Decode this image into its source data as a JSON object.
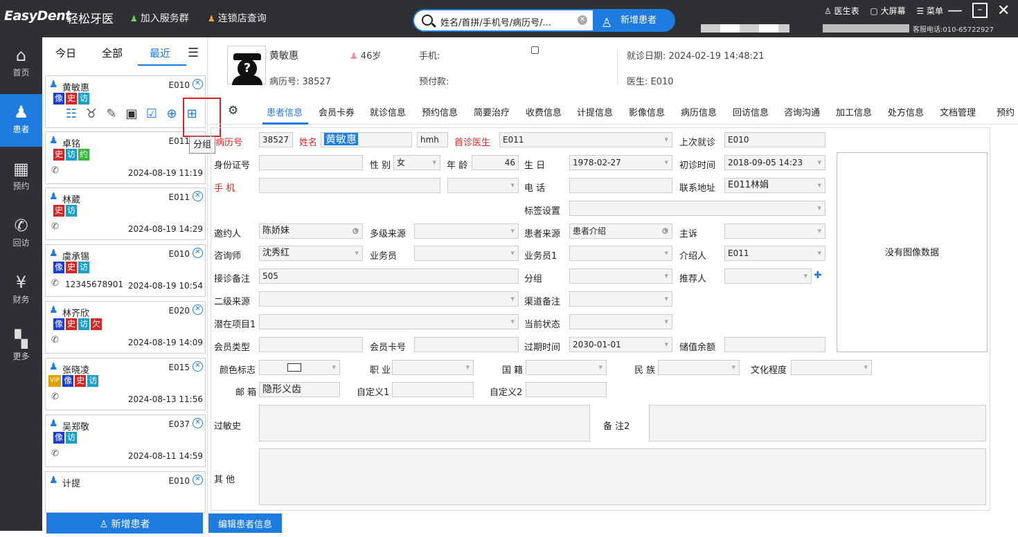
{
  "app": {
    "logo": "EasyDent",
    "logo_cn": "轻松牙医",
    "join_group": "加入服务群",
    "chain_query": "连锁店查询",
    "search_placeholder": "姓名/首拼/手机号/病历号/...",
    "new_patient": "新增患者",
    "doctor_table": "医生表",
    "big_screen": "大屏幕",
    "menu": "菜单",
    "service_phone": "客服电话:010-65722927"
  },
  "nav": [
    {
      "label": "首页",
      "icon": "home-icon"
    },
    {
      "label": "患者",
      "icon": "patient-icon"
    },
    {
      "label": "预约",
      "icon": "calendar-icon"
    },
    {
      "label": "回访",
      "icon": "phone-icon"
    },
    {
      "label": "财务",
      "icon": "yuan-icon"
    },
    {
      "label": "更多",
      "icon": "grid-icon"
    }
  ],
  "list_tabs": {
    "today": "今日",
    "all": "全部",
    "recent": "最近"
  },
  "patients": [
    {
      "name": "黄敏惠",
      "code": "E010",
      "tags": [
        "像",
        "史",
        "访"
      ],
      "phone": "",
      "date": ""
    },
    {
      "name": "卓铭",
      "code": "E011",
      "tags": [
        "史",
        "访",
        "约"
      ],
      "phone": "",
      "date": "2024-08-19 11:19"
    },
    {
      "name": "林葳",
      "code": "E011",
      "tags": [
        "史",
        "访"
      ],
      "phone": "",
      "date": "2024-08-19 14:29"
    },
    {
      "name": "虞承锡",
      "code": "E010",
      "tags": [
        "像",
        "史",
        "访"
      ],
      "phone": "12345678901",
      "date": "2024-08-19 10:54"
    },
    {
      "name": "林齐欣",
      "code": "E020",
      "tags": [
        "像",
        "史",
        "访",
        "欠"
      ],
      "phone": "",
      "date": "2024-08-19 14:09"
    },
    {
      "name": "张晓凌",
      "code": "E015",
      "tags": [
        "VIP",
        "像",
        "史",
        "访"
      ],
      "phone": "",
      "date": "2024-08-13 11:56"
    },
    {
      "name": "吴郑敬",
      "code": "E037",
      "tags": [
        "像",
        "访"
      ],
      "phone": "",
      "date": "2024-08-11 14:59"
    },
    {
      "name": "计提",
      "code": "E010",
      "tags": [],
      "phone": "",
      "date": ""
    }
  ],
  "tooltip": "分组",
  "new_patient_bottom": "新增患者",
  "header": {
    "name": "黄敏惠",
    "age": "46岁",
    "record_label": "病历号:",
    "record_no": "38527",
    "phone_label": "手机:",
    "prepay_label": "预付款:",
    "visit_date": "就诊日期: 2024-02-19 14:48:21",
    "doctor": "医生: E010"
  },
  "tabs": [
    "患者信息",
    "会员卡券",
    "就诊信息",
    "预约信息",
    "简要治疗",
    "收费信息",
    "计提信息",
    "影像信息",
    "病历信息",
    "回访信息",
    "咨询沟通",
    "加工信息",
    "处方信息",
    "文档管理",
    "预约"
  ],
  "form": {
    "record_no_label": "病历号",
    "record_no": "38527",
    "name_label": "姓名",
    "name": "黄敏惠",
    "pinyin": "hmh",
    "first_doc_label": "首诊医生",
    "first_doc": "E011",
    "last_visit_label": "上次就诊",
    "last_visit": "E010",
    "id_label": "身份证号",
    "gender_label": "性 别",
    "gender": "女",
    "age_label": "年 龄",
    "age": "46",
    "birthday_label": "生 日",
    "birthday": "1978-02-27",
    "first_time_label": "初诊时间",
    "first_time": "2018-09-05 14:23",
    "mobile_label": "手 机",
    "tel_label": "电 话",
    "address_label": "联系地址",
    "address": "E011林娟",
    "tag_label": "标签设置",
    "inviter_label": "邀约人",
    "inviter": "陈娇妹",
    "multi_src_label": "多级来源",
    "source_label": "患者来源",
    "source": "患者介绍",
    "complaint_label": "主诉",
    "consultant_label": "咨询师",
    "consultant": "沈秀红",
    "salesman_label": "业务员",
    "salesman1_label": "业务员1",
    "introducer_label": "介绍人",
    "introducer": "E011",
    "reception_label": "接诊备注",
    "reception": "505",
    "group_label": "分组",
    "recommender_label": "推荐人",
    "src2_label": "二级来源",
    "channel_label": "渠道备注",
    "potential_label": "潜在项目1",
    "status_label": "当前状态",
    "member_type_label": "会员类型",
    "member_card_label": "会员卡号",
    "expire_label": "过期时间",
    "expire": "2030-01-01",
    "balance_label": "储值余额",
    "color_label": "颜色标志",
    "job_label": "职 业",
    "nation_label": "国 籍",
    "ethnic_label": "民 族",
    "edu_label": "文化程度",
    "email_label": "邮 箱",
    "email": "隐形义齿",
    "custom1_label": "自定义1",
    "custom2_label": "自定义2",
    "allergy_label": "过敏史",
    "note2_label": "备 注2",
    "other_label": "其 他",
    "no_image": "没有图像数据"
  },
  "edit_button": "编辑患者信息"
}
